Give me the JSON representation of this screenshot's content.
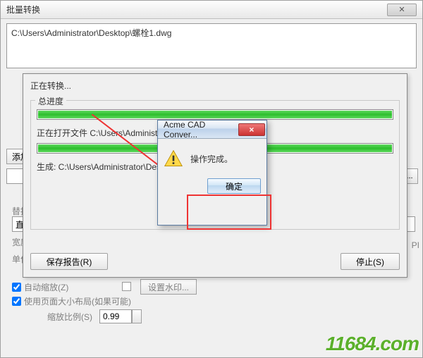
{
  "main": {
    "title": "批量转换",
    "file_path": "C:\\Users\\Administrator\\Desktop\\螺栓1.dwg",
    "add_file": "添加",
    "browse": "..."
  },
  "options": {
    "replace_label": "替换",
    "direct_mode": "直接",
    "width_label": "宽度",
    "unit_label": "单位",
    "auto_zoom": "自动缩放(Z)",
    "use_page_layout": "使用页面大小布局(如果可能)",
    "scale_label": "缩放比例(S)",
    "scale_value": "0.99",
    "watermark_btn": "设置水印...",
    "pi_label": "PI"
  },
  "progress": {
    "converting": "正在转换...",
    "overall": "总进度",
    "opening_file": "正在打开文件 C:\\Users\\Administrator\\",
    "generated": "生成: C:\\Users\\Administrator\\Desk",
    "save_report": "保存报告(R)",
    "stop": "停止(S)"
  },
  "msg": {
    "title": "Acme CAD Conver...",
    "close_x": "×",
    "text": "操作完成。",
    "ok": "确定"
  },
  "brand": "11684",
  "brand_suffix": ".com"
}
